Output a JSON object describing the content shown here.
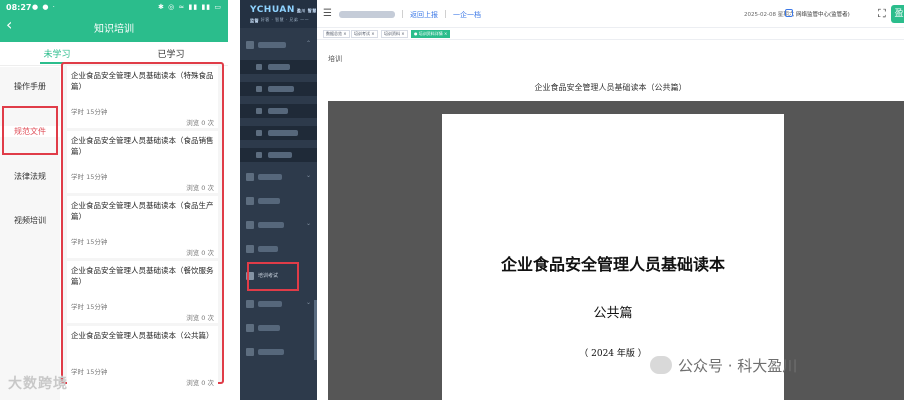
{
  "phone": {
    "status_time": "08:27",
    "status_dots": "● ● ·",
    "status_right": "✱ ◎ ≈ ▮▮ ▮▮ ▭",
    "nav_title": "知识培训",
    "tabs": [
      {
        "label": "未学习"
      },
      {
        "label": "已学习"
      }
    ],
    "categories": [
      {
        "label": "操作手册"
      },
      {
        "label": "规范文件"
      },
      {
        "label": "法律法规"
      },
      {
        "label": "视频培训"
      }
    ],
    "docs": [
      {
        "title": "企业食品安全管理人员基础读本（特殊食品篇）",
        "hours": "学时 15分钟",
        "views": "浏览 0 次"
      },
      {
        "title": "企业食品安全管理人员基础读本（食品销售篇）",
        "hours": "学时 15分钟",
        "views": "浏览 0 次"
      },
      {
        "title": "企业食品安全管理人员基础读本（食品生产篇）",
        "hours": "学时 15分钟",
        "views": "浏览 0 次"
      },
      {
        "title": "企业食品安全管理人员基础读本（餐饮服务篇）",
        "hours": "学时 15分钟",
        "views": "浏览 0 次"
      },
      {
        "title": "企业食品安全管理人员基础读本（公共篇）",
        "hours": "学时 15分钟",
        "views": "浏览 0 次"
      }
    ],
    "watermark": "大数跨境"
  },
  "desktop": {
    "logo": "YCHUAN",
    "logo_suffix": "盈川 智慧监管",
    "logo_sub": "—— 好客 · 智慧 · 兄弟 ——",
    "menu": {
      "training_exam_label": "培训考试"
    },
    "topbar": {
      "report_link": "返回上报",
      "one_link": "一企一档",
      "date": "2025-02-08 星期六",
      "center": "网络监管中心(监管者)",
      "avatar_char": "盈"
    },
    "tags": [
      {
        "label": "数据总览 ×"
      },
      {
        "label": "培训考试 ×"
      },
      {
        "label": "培训资料 ×"
      },
      {
        "label": "● 培训资料详情 ×"
      }
    ],
    "breadcrumb": "培训",
    "doc_heading": "企业食品安全管理人员基础读本（公共篇）",
    "pdf": {
      "title": "企业食品安全管理人员基础读本",
      "subtitle": "公共篇",
      "year": "（ 2024 年版 ）"
    },
    "watermark": "公众号 · 科大盈川"
  },
  "colors": {
    "accent_green": "#2bbd8c",
    "highlight_red": "#e03c48",
    "sidebar_dark": "#2d3a4b",
    "link_blue": "#3b78e7"
  }
}
